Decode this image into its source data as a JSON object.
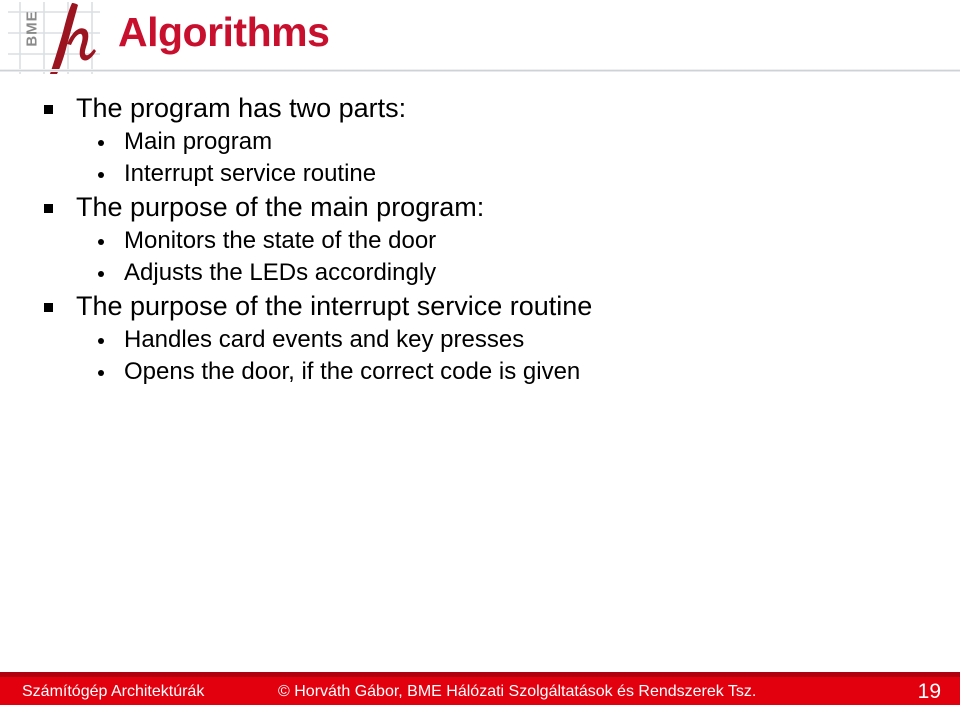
{
  "header": {
    "title": "Algorithms",
    "logo": {
      "institution_abbr": "BME",
      "mark_icon": "bme-h-logo-icon"
    }
  },
  "content": {
    "bullets": [
      {
        "level": 1,
        "marker": "square-bullet-icon",
        "text": "The program has two parts:"
      },
      {
        "level": 2,
        "marker": "dot-bullet-icon",
        "text": "Main program"
      },
      {
        "level": 2,
        "marker": "dot-bullet-icon",
        "text": "Interrupt service routine"
      },
      {
        "level": 1,
        "marker": "square-bullet-icon",
        "text": "The purpose of the main program:"
      },
      {
        "level": 2,
        "marker": "dot-bullet-icon",
        "text": "Monitors the state of the door"
      },
      {
        "level": 2,
        "marker": "dot-bullet-icon",
        "text": "Adjusts the LEDs accordingly"
      },
      {
        "level": 1,
        "marker": "square-bullet-icon",
        "text": "The purpose of the interrupt service routine"
      },
      {
        "level": 2,
        "marker": "dot-bullet-icon",
        "text": "Handles card events and key presses"
      },
      {
        "level": 2,
        "marker": "dot-bullet-icon",
        "text": "Opens the door, if the correct code is given"
      }
    ]
  },
  "footer": {
    "course": "Számítógép Architektúrák",
    "copyright": "© Horváth Gábor, BME Hálózati Szolgáltatások és Rendszerek Tsz.",
    "page_number": "19"
  },
  "colors": {
    "title_red": "#c8102e",
    "footer_red": "#e2000f",
    "footer_top_border": "#b00010",
    "logo_gray": "#8a8a8a",
    "body_text": "#000000"
  }
}
